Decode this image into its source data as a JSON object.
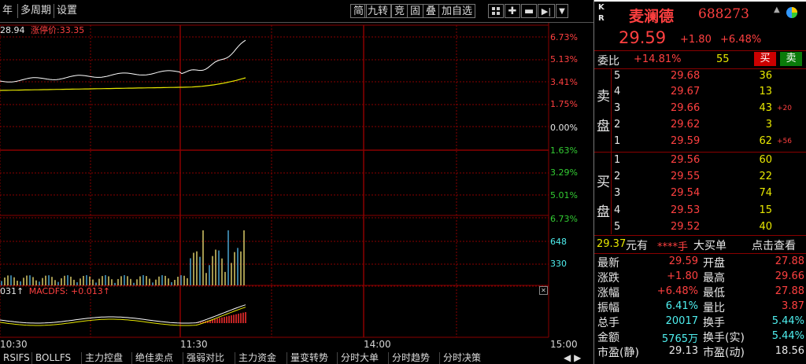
{
  "toolbar": {
    "left_items": [
      "年",
      "多周期",
      "设置"
    ],
    "right_items": [
      "简",
      "九转",
      "竞",
      "固",
      "叠",
      "加自选"
    ],
    "icons": [
      "grid-icon",
      "plus-icon",
      "minus-icon",
      "skip-right-icon",
      "dropdown-icon"
    ]
  },
  "chart": {
    "price_prefix": "28.94",
    "limit_label": "涨停价:33.35",
    "right_axis_up": [
      "6.73%",
      "5.13%",
      "3.41%",
      "1.75%"
    ],
    "right_axis_zero": "0.00%",
    "right_axis_down": [
      "1.63%",
      "3.29%",
      "5.01%",
      "6.73%"
    ],
    "volume_labels": [
      "648",
      "330"
    ],
    "macd_prefix": "031↑",
    "macd_label": "MACDFS: +0.013↑",
    "time_labels": [
      "10:30",
      "11:30",
      "14:00",
      "15:00"
    ],
    "colors": {
      "price_line": "#ffffff",
      "avg_line": "#e8e800",
      "grid": "#8a0000",
      "vol_up": "#e8d870",
      "vol_down": "#4fb0e0"
    }
  },
  "bottom_tabs": [
    "RSIFS",
    "BOLLFS",
    "主力控盘",
    "绝佳卖点",
    "强弱对比",
    "主力资金",
    "量变转势",
    "分时大单",
    "分时趋势",
    "分时决策"
  ],
  "stock": {
    "kr": [
      "K",
      "R"
    ],
    "name": "麦澜德",
    "code": "688273",
    "price": "29.59",
    "change": "+1.80",
    "change_pct": "+6.48%",
    "weibi_label": "委比",
    "weibi_value": "+14.81%",
    "weicha_value": "55",
    "buy_btn": "买",
    "sell_btn": "卖"
  },
  "sell_side_label": [
    "卖",
    "盘"
  ],
  "buy_side_label": [
    "买",
    "盘"
  ],
  "sell_orders": [
    {
      "idx": "5",
      "price": "29.68",
      "qty": "36",
      "delta": ""
    },
    {
      "idx": "4",
      "price": "29.67",
      "qty": "13",
      "delta": ""
    },
    {
      "idx": "3",
      "price": "29.66",
      "qty": "43",
      "delta": "+20"
    },
    {
      "idx": "2",
      "price": "29.62",
      "qty": "3",
      "delta": ""
    },
    {
      "idx": "1",
      "price": "29.59",
      "qty": "62",
      "delta": "+56"
    }
  ],
  "buy_orders": [
    {
      "idx": "1",
      "price": "29.56",
      "qty": "60"
    },
    {
      "idx": "2",
      "price": "29.55",
      "qty": "22"
    },
    {
      "idx": "3",
      "price": "29.54",
      "qty": "74"
    },
    {
      "idx": "4",
      "price": "29.53",
      "qty": "15"
    },
    {
      "idx": "5",
      "price": "29.52",
      "qty": "40"
    }
  ],
  "big_order": {
    "price": "29.37",
    "unit": "元有",
    "hand": "****手",
    "label": "大买单",
    "link": "点击查看"
  },
  "stats": [
    {
      "l1": "最新",
      "v1": "29.59",
      "c1": "red",
      "l2": "开盘",
      "v2": "27.88",
      "c2": "red"
    },
    {
      "l1": "涨跌",
      "v1": "+1.80",
      "c1": "red",
      "l2": "最高",
      "v2": "29.66",
      "c2": "red"
    },
    {
      "l1": "涨幅",
      "v1": "+6.48%",
      "c1": "red",
      "l2": "最低",
      "v2": "27.88",
      "c2": "red"
    },
    {
      "l1": "振幅",
      "v1": "6.41%",
      "c1": "cyan",
      "l2": "量比",
      "v2": "3.87",
      "c2": "red"
    },
    {
      "l1": "总手",
      "v1": "20017",
      "c1": "cyan",
      "l2": "换手",
      "v2": "5.44%",
      "c2": "cyan"
    },
    {
      "l1": "金额",
      "v1": "5765万",
      "c1": "cyan",
      "l2": "换手(实)",
      "v2": "5.44%",
      "c2": "cyan"
    },
    {
      "l1": "市盈(静)",
      "v1": "29.13",
      "c1": "white",
      "l2": "市盈(动)",
      "v2": "18.56",
      "c2": "white"
    }
  ]
}
